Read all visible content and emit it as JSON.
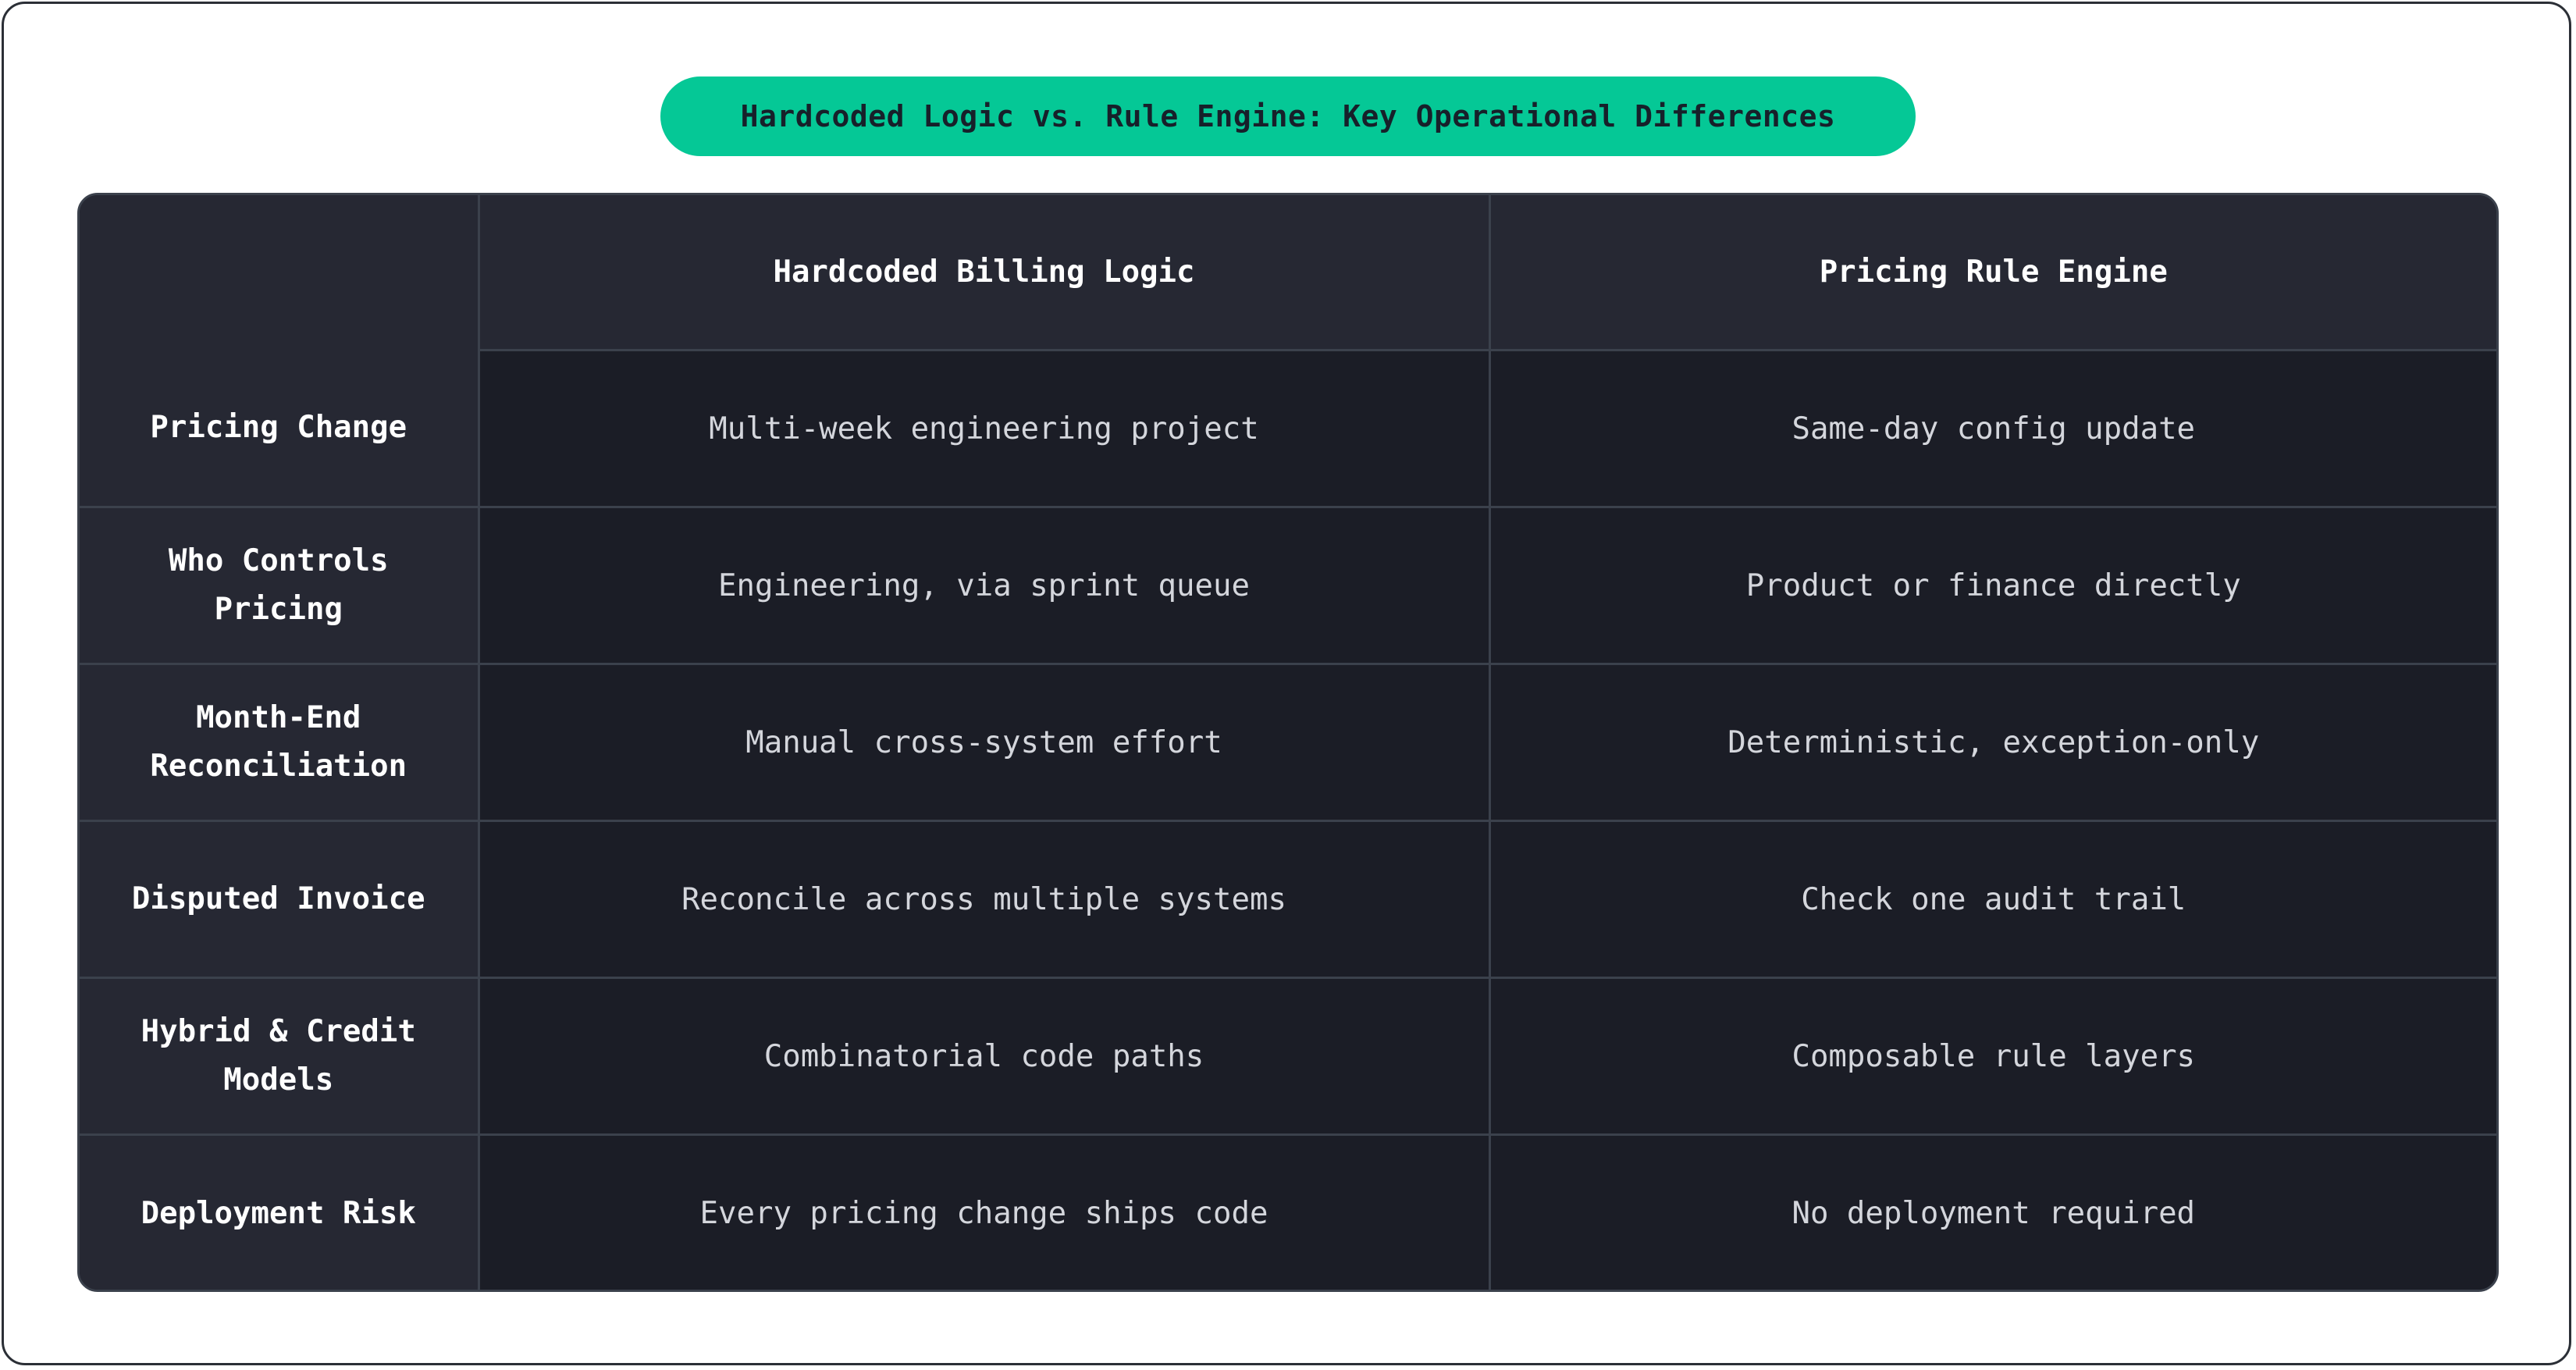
{
  "title": "Hardcoded Logic vs. Rule Engine: Key Operational Differences",
  "columns": [
    "",
    "Hardcoded Billing Logic",
    "Pricing Rule Engine"
  ],
  "rows": [
    {
      "label": "Pricing Change",
      "hardcoded": "Multi-week engineering project",
      "engine": "Same-day config update"
    },
    {
      "label": "Who Controls Pricing",
      "hardcoded": "Engineering, via sprint queue",
      "engine": "Product or finance directly"
    },
    {
      "label": "Month-End Reconciliation",
      "hardcoded": "Manual cross-system effort",
      "engine": "Deterministic, exception-only"
    },
    {
      "label": "Disputed Invoice",
      "hardcoded": "Reconcile across multiple systems",
      "engine": "Check one audit trail"
    },
    {
      "label": "Hybrid & Credit Models",
      "hardcoded": "Combinatorial code paths",
      "engine": "Composable rule layers"
    },
    {
      "label": "Deployment Risk",
      "hardcoded": "Every pricing change ships code",
      "engine": "No deployment required"
    }
  ],
  "colors": {
    "accent": "#05c896",
    "header_bg": "#262833",
    "cell_bg": "#1b1d26",
    "grid": "#3b414c",
    "header_text": "#ffffff",
    "cell_text": "#d4d6dc"
  }
}
